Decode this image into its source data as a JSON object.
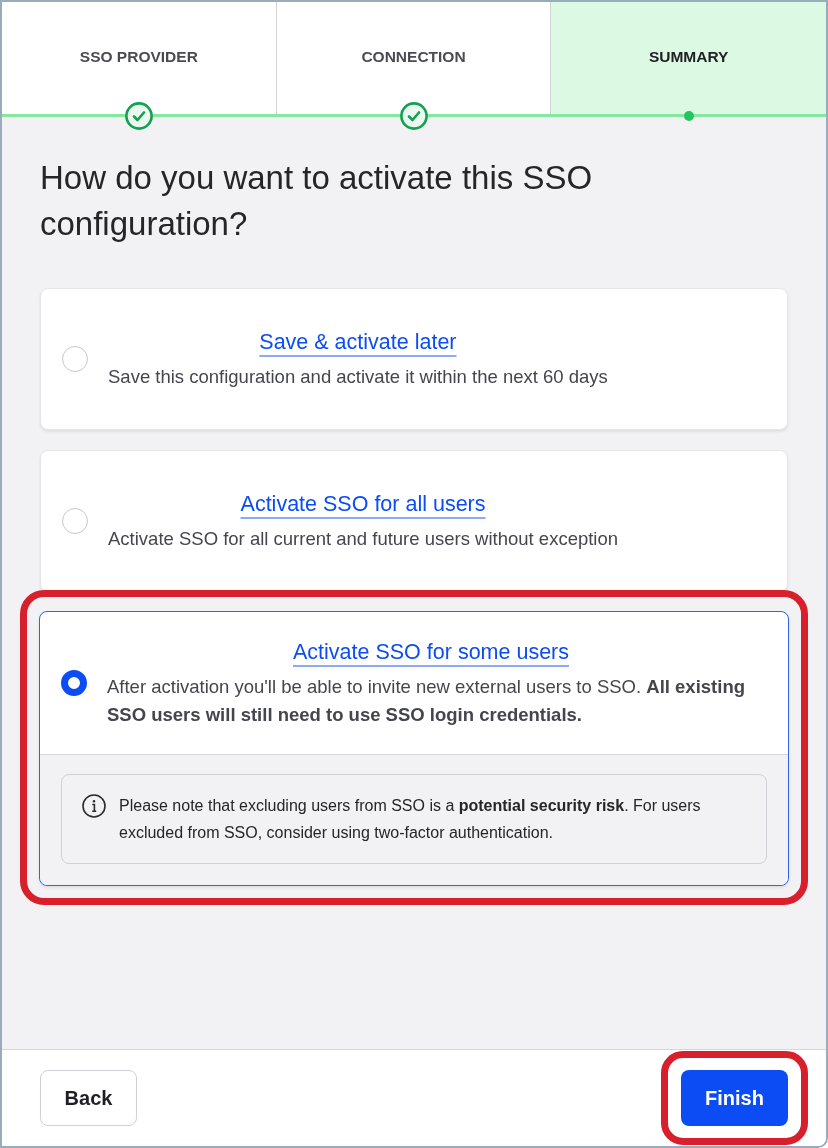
{
  "steps": [
    {
      "label": "SSO PROVIDER",
      "completed": true,
      "selected": false
    },
    {
      "label": "CONNECTION",
      "completed": true,
      "selected": false
    },
    {
      "label": "SUMMARY",
      "completed": false,
      "selected": true
    }
  ],
  "heading": "How do you want to activate this SSO configuration?",
  "options": [
    {
      "title": "Save & activate later",
      "description": "Save this configuration and activate it within the next 60 days",
      "selected": false,
      "highlighted": false
    },
    {
      "title": "Activate SSO for all users",
      "description": "Activate SSO for all current and future users without exception",
      "selected": false,
      "highlighted": false
    },
    {
      "title": "Activate SSO for some users",
      "description": "After activation you'll be able to invite new external users to SSO. **All existing SSO users will still need to use SSO login credentials.**",
      "selected": true,
      "highlighted": true,
      "note": "Please note that excluding users from SSO is a **potential security risk**. For users excluded from SSO, consider using two-factor authentication."
    }
  ],
  "footer": {
    "back": {
      "label": "Back"
    },
    "finish": {
      "label": "Finish",
      "highlighted": true
    }
  }
}
